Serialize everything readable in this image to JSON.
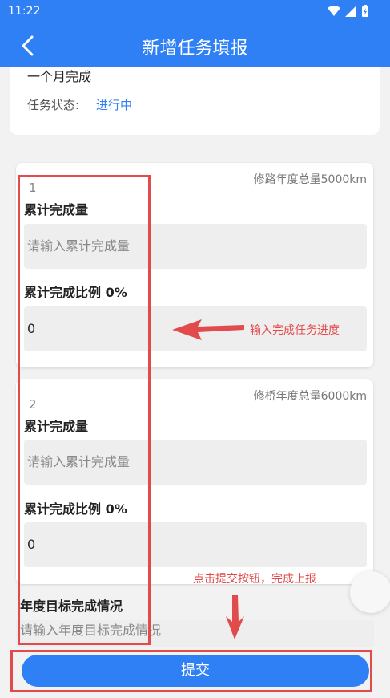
{
  "status_bar": {
    "time": "11:22"
  },
  "header": {
    "title": "新增任务填报"
  },
  "info": {
    "period_text": "一个月完成",
    "status_label": "任务状态:",
    "status_value": "进行中"
  },
  "tasks": [
    {
      "index": "1",
      "goal": "修路年度总量5000km",
      "amount_label": "累计完成量",
      "amount_placeholder": "请输入累计完成量",
      "ratio_label": "累计完成比例 0%",
      "ratio_value": "0"
    },
    {
      "index": "2",
      "goal": "修桥年度总量6000km",
      "amount_label": "累计完成量",
      "amount_placeholder": "请输入累计完成量",
      "ratio_label": "累计完成比例 0%",
      "ratio_value": "0"
    }
  ],
  "year_target": {
    "label": "年度目标完成情况",
    "placeholder": "请输入年度目标完成情况"
  },
  "submit": {
    "label": "提交"
  },
  "annotations": {
    "progress_hint": "输入完成任务进度",
    "submit_hint": "点击提交按钮，完成上报",
    "color": "#e24b4b"
  },
  "colors": {
    "primary": "#2f80f5"
  }
}
